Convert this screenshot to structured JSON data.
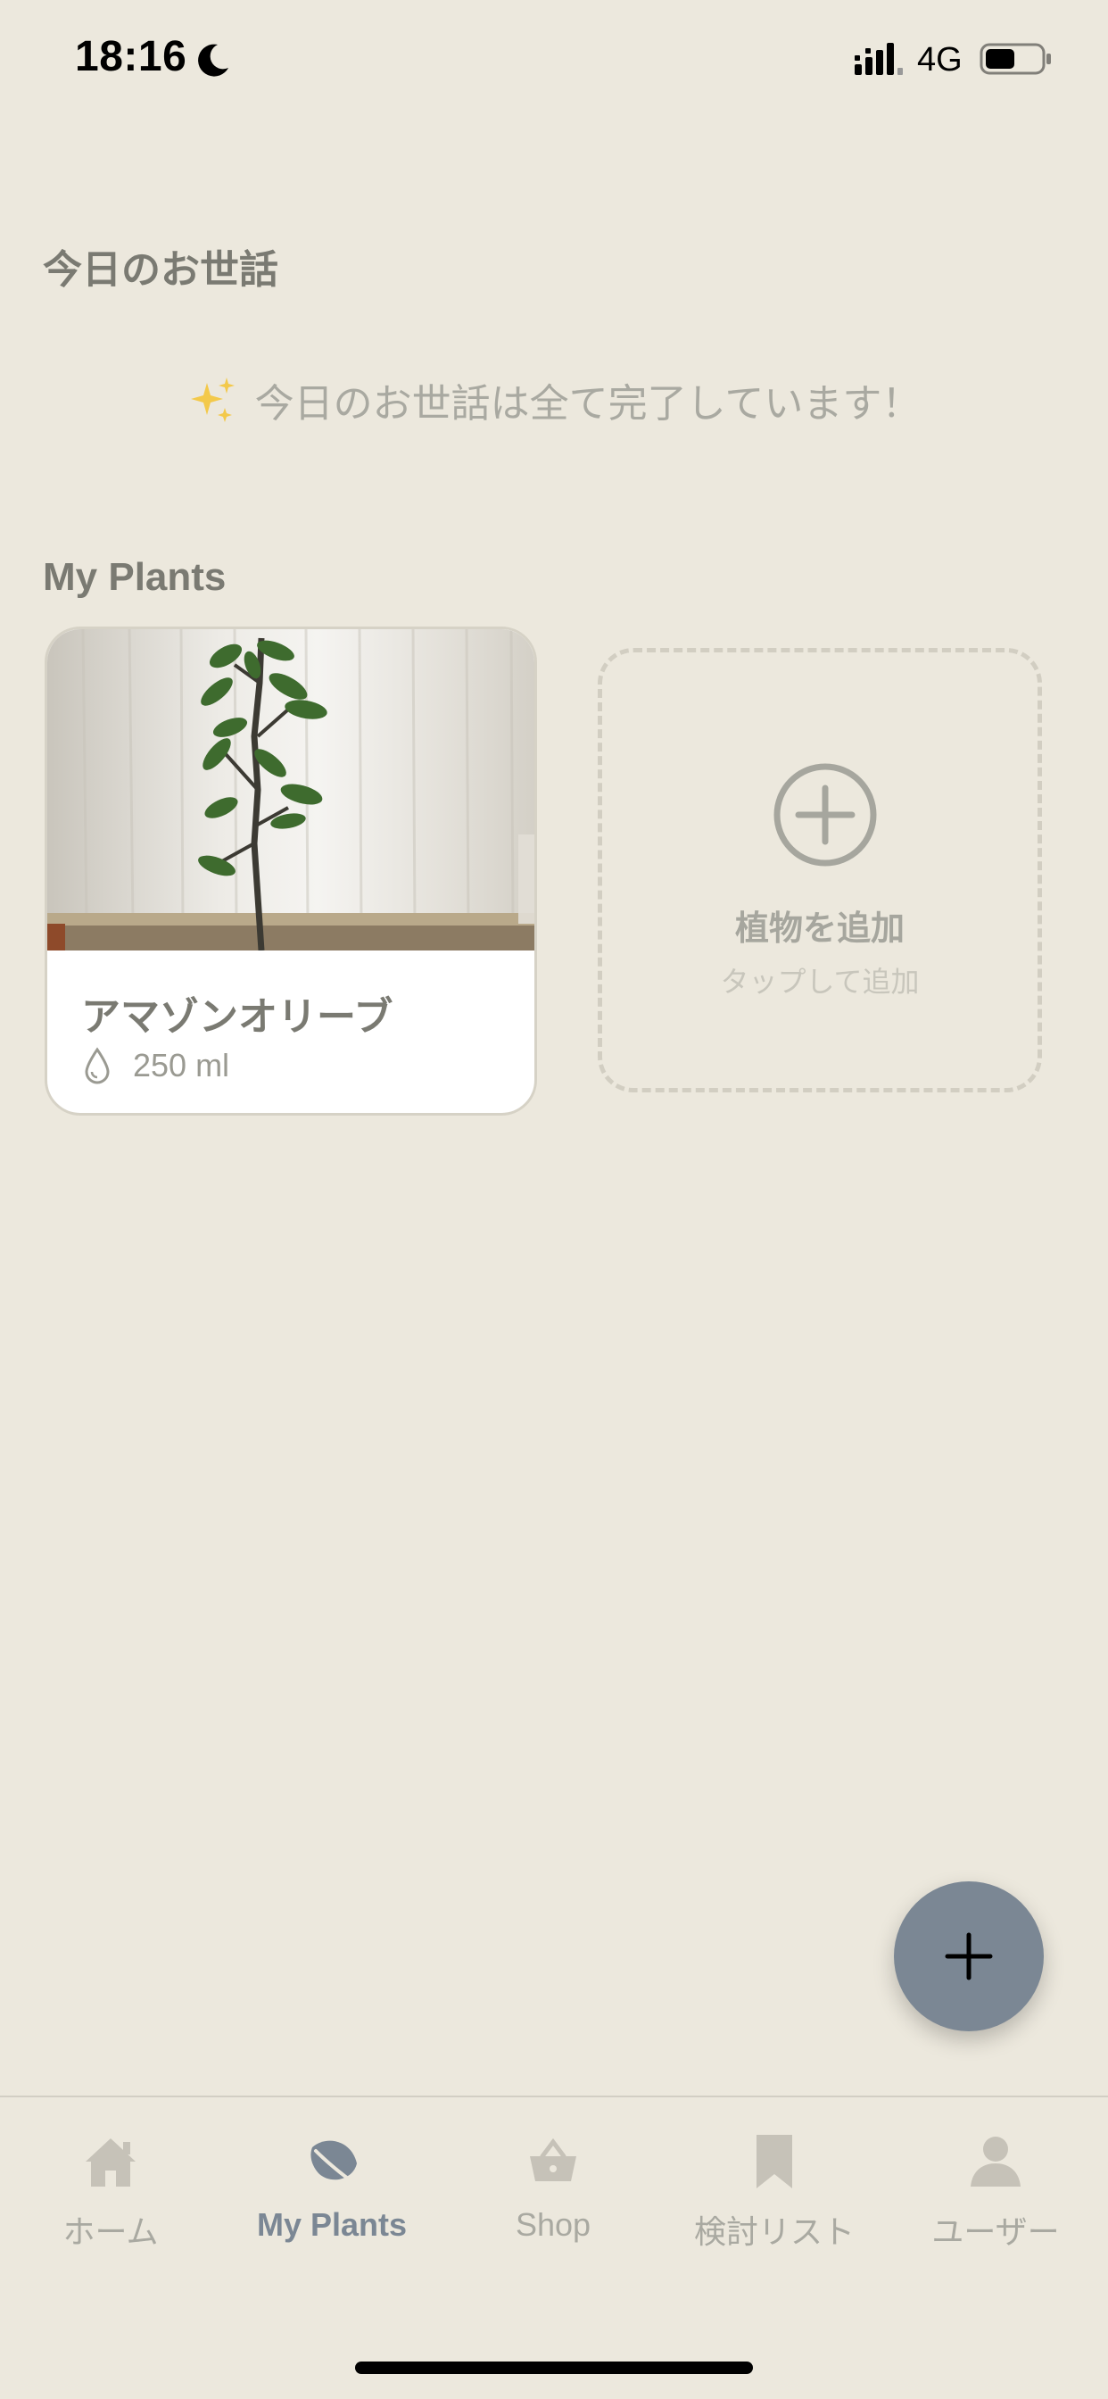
{
  "status_bar": {
    "time": "18:16",
    "network": "4G",
    "icons": [
      "moon-icon",
      "signal-icon",
      "battery-icon"
    ]
  },
  "today": {
    "title": "今日のお世話",
    "message": "今日のお世話は全て完了しています！",
    "message_icon": "sparkle-icon"
  },
  "plants": {
    "title": "My Plants",
    "items": [
      {
        "name": "アマゾンオリーブ",
        "water": "250 ml",
        "water_icon": "drop-icon"
      }
    ],
    "add_card": {
      "title": "植物を追加",
      "subtitle": "タップして追加",
      "icon": "plus-circle-icon"
    }
  },
  "fab": {
    "icon": "plus-icon"
  },
  "tab_bar": {
    "active": "My Plants",
    "tabs": [
      {
        "label": "ホーム",
        "icon": "home-icon"
      },
      {
        "label": "My Plants",
        "icon": "leaf-icon"
      },
      {
        "label": "Shop",
        "icon": "basket-icon"
      },
      {
        "label": "検討リスト",
        "icon": "bookmark-icon"
      },
      {
        "label": "ユーザー",
        "icon": "user-icon"
      }
    ]
  },
  "colors": {
    "background": "#ECE8DD",
    "accent": "#7B8794",
    "text_heading": "#7A7A72",
    "text_muted": "#A9A9A1",
    "card_border": "#D6D2C6"
  }
}
